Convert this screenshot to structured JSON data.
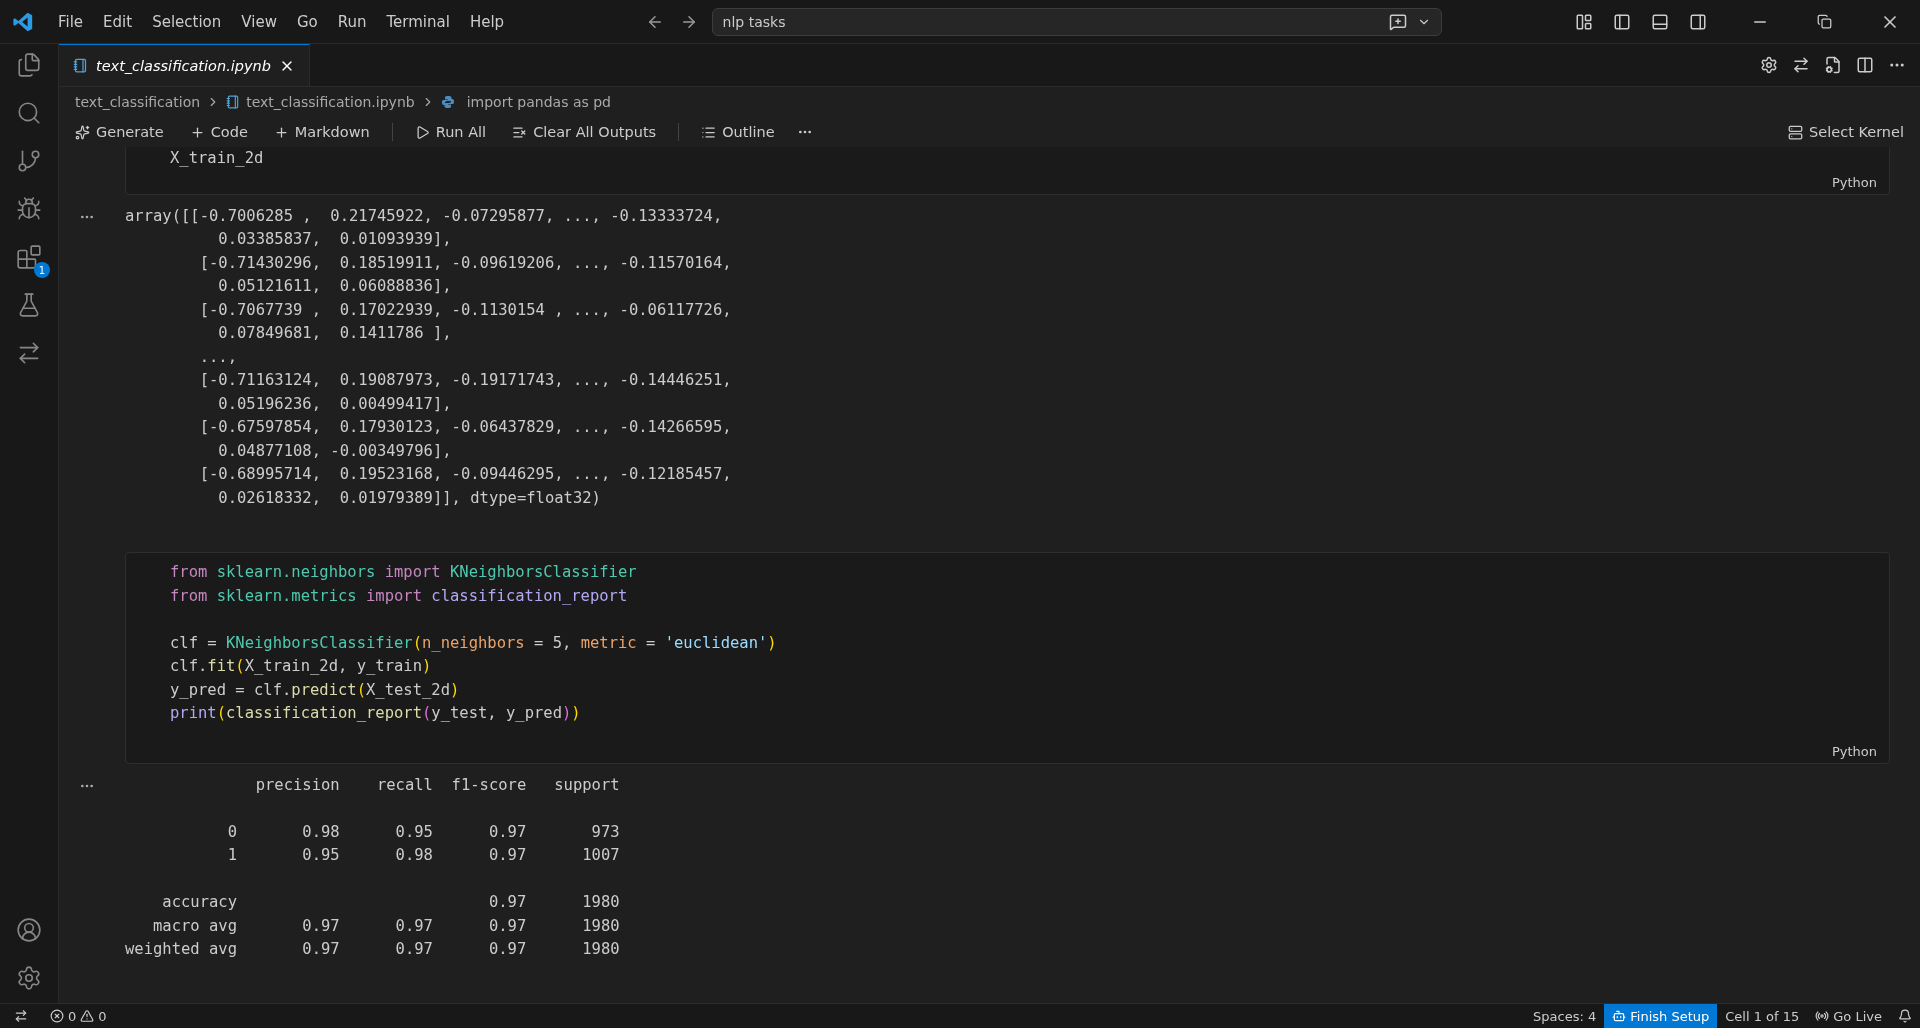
{
  "menu": [
    "File",
    "Edit",
    "Selection",
    "View",
    "Go",
    "Run",
    "Terminal",
    "Help"
  ],
  "search": {
    "value": "nlp tasks"
  },
  "activity_bar": {
    "extensions_badge": "1"
  },
  "tabs": [
    {
      "label": "text_classification.ipynb",
      "selected": true
    }
  ],
  "breadcrumbs": [
    "text_classification",
    "text_classification.ipynb",
    "import pandas as pd"
  ],
  "toolbar": [
    {
      "kind": "generate",
      "label": "Generate"
    },
    {
      "kind": "add",
      "label": "Code"
    },
    {
      "kind": "add",
      "label": "Markdown"
    },
    {
      "kind": "run",
      "label": "Run All"
    },
    {
      "kind": "clear",
      "label": "Clear All Outputs"
    },
    {
      "kind": "outline",
      "label": "Outline"
    }
  ],
  "kernel": "Select Kernel",
  "cells": [
    {
      "language": "Python",
      "blocks": [
        [
          [
            {
              "t": "X_train_2d",
              "kind": "plain"
            }
          ]
        ]
      ],
      "output": [
        [
          "array([[-0.7006285 ,  0.21745922, -0.07295877, ..., -0.13333724,",
          "          0.03385837,  0.01093939],",
          "        [-0.71430296,  0.18519911, -0.09619206, ..., -0.11570164,",
          "          0.05121611,  0.06088836],",
          "        [-0.7067739 ,  0.17022939, -0.1130154 , ..., -0.06117726,",
          "          0.07849681,  0.1411786 ],",
          "        ...,",
          "        [-0.71163124,  0.19087973, -0.19171743, ..., -0.14446251,",
          "          0.05196236,  0.00499417],",
          "        [-0.67597854,  0.17930123, -0.06437829, ..., -0.14266595,",
          "          0.04877108, -0.00349796],",
          "        [-0.68995714,  0.19523168, -0.09446295, ..., -0.12185457,",
          "          0.02618332,  0.01979389]], dtype=float32)"
        ]
      ]
    },
    {
      "language": "Python",
      "blocks": [
        [
          [
            {
              "t": "from",
              "kind": "kw"
            },
            {
              "t": " sklearn.neighbors ",
              "kind": "mod"
            },
            {
              "t": "import",
              "kind": "kw"
            },
            {
              "t": " KNeighborsClassifier",
              "kind": "cls"
            }
          ],
          [
            {
              "t": "from",
              "kind": "kw"
            },
            {
              "t": " sklearn.metrics ",
              "kind": "mod"
            },
            {
              "t": "import",
              "kind": "kw"
            },
            {
              "t": " classification_report",
              "kind": "fn2"
            }
          ]
        ],
        [
          [
            {
              "t": "clf = ",
              "kind": "plain"
            },
            {
              "t": "KNeighborsClassifier",
              "kind": "cls"
            },
            {
              "t": "(",
              "kind": "br1"
            },
            {
              "t": "n_neighbors",
              "kind": "param"
            },
            {
              "t": " = 5, ",
              "kind": "plain"
            },
            {
              "t": "metric",
              "kind": "param"
            },
            {
              "t": " = ",
              "kind": "plain"
            },
            {
              "t": "'euclidean'",
              "kind": "str"
            },
            {
              "t": ")",
              "kind": "br1"
            }
          ],
          [
            {
              "t": "clf.",
              "kind": "plain"
            },
            {
              "t": "fit",
              "kind": "fn"
            },
            {
              "t": "(",
              "kind": "br1"
            },
            {
              "t": "X_train_2d, y_train",
              "kind": "plain"
            },
            {
              "t": ")",
              "kind": "br1"
            }
          ],
          [
            {
              "t": "y_pred = clf.",
              "kind": "plain"
            },
            {
              "t": "predict",
              "kind": "fn"
            },
            {
              "t": "(",
              "kind": "br1"
            },
            {
              "t": "X_test_2d",
              "kind": "plain"
            },
            {
              "t": ")",
              "kind": "br1"
            }
          ],
          [
            {
              "t": "print",
              "kind": "fn2"
            },
            {
              "t": "(",
              "kind": "br1"
            },
            {
              "t": "classification_report",
              "kind": "fn"
            },
            {
              "t": "(",
              "kind": "br2"
            },
            {
              "t": "y_test, y_pred",
              "kind": "plain"
            },
            {
              "t": ")",
              "kind": "br2"
            },
            {
              "t": ")",
              "kind": "br1"
            }
          ]
        ]
      ],
      "output": [
        [
          "              precision    recall  f1-score   support"
        ],
        [
          "           0       0.98      0.95      0.97       973",
          "           1       0.95      0.98      0.97      1007"
        ],
        [
          "    accuracy                           0.97      1980",
          "   macro avg       0.97      0.97      0.97      1980",
          "weighted avg       0.97      0.97      0.97      1980"
        ]
      ]
    }
  ],
  "status_bar": {
    "errors": "0",
    "warnings": "0",
    "right": [
      {
        "kind": "text",
        "label": "Spaces: 4"
      },
      {
        "kind": "setup",
        "label": "Finish Setup"
      },
      {
        "kind": "text",
        "label": "Cell 1 of 15"
      },
      {
        "kind": "live",
        "label": "Go Live"
      }
    ]
  }
}
